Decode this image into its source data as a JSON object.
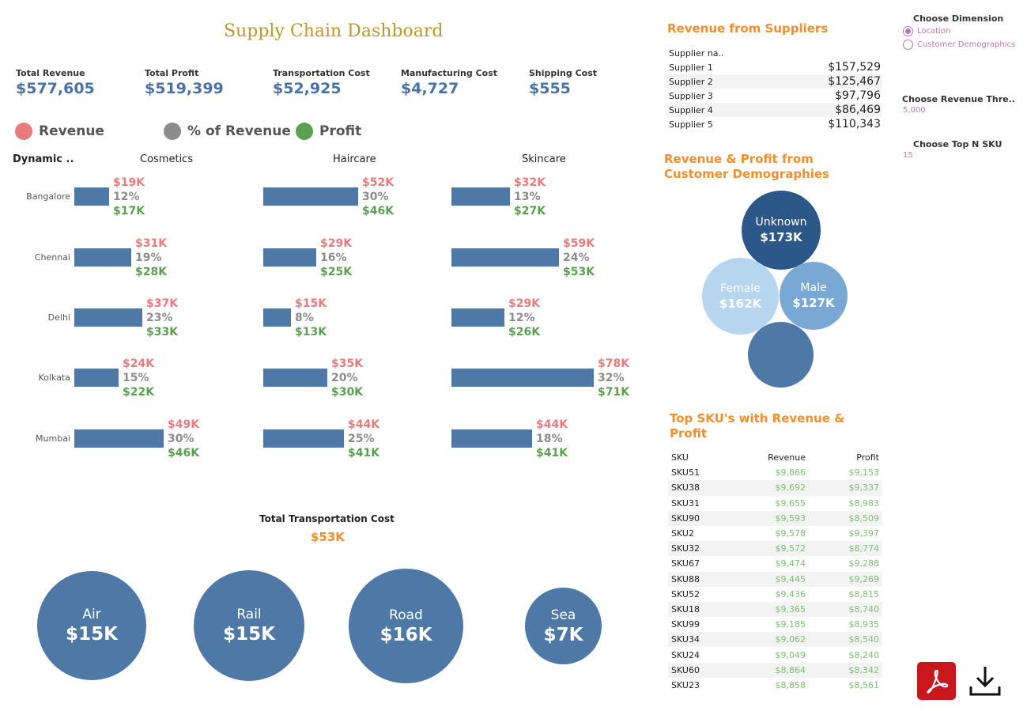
{
  "title": "Supply Chain Dashboard",
  "kpis": [
    {
      "label": "Total Revenue",
      "value": "$577,605"
    },
    {
      "label": "Total Profit",
      "value": "$519,399"
    },
    {
      "label": "Transportation Cost",
      "value": "$52,925"
    },
    {
      "label": "Manufacturing Cost",
      "value": "$4,727"
    },
    {
      "label": "Shipping Cost",
      "value": "$555"
    }
  ],
  "legend": [
    {
      "label": "Revenue",
      "color": "#e87b7b"
    },
    {
      "label": "% of Revenue",
      "color": "#8c8c8c"
    },
    {
      "label": "Profit",
      "color": "#59a14f"
    }
  ],
  "matrix": {
    "dimension_label": "Dynamic ..",
    "columns": [
      "Cosmetics",
      "Haircare",
      "Skincare"
    ],
    "rows": [
      "Bangalore",
      "Chennai",
      "Delhi",
      "Kolkata",
      "Mumbai"
    ],
    "cells": [
      [
        {
          "revenue": "$19K",
          "pct": "12%",
          "profit": "$17K",
          "value": 19
        },
        {
          "revenue": "$52K",
          "pct": "30%",
          "profit": "$46K",
          "value": 52
        },
        {
          "revenue": "$32K",
          "pct": "13%",
          "profit": "$27K",
          "value": 32
        }
      ],
      [
        {
          "revenue": "$31K",
          "pct": "19%",
          "profit": "$28K",
          "value": 31
        },
        {
          "revenue": "$29K",
          "pct": "16%",
          "profit": "$25K",
          "value": 29
        },
        {
          "revenue": "$59K",
          "pct": "24%",
          "profit": "$53K",
          "value": 59
        }
      ],
      [
        {
          "revenue": "$37K",
          "pct": "23%",
          "profit": "$33K",
          "value": 37
        },
        {
          "revenue": "$15K",
          "pct": "8%",
          "profit": "$13K",
          "value": 15
        },
        {
          "revenue": "$29K",
          "pct": "12%",
          "profit": "$26K",
          "value": 29
        }
      ],
      [
        {
          "revenue": "$24K",
          "pct": "15%",
          "profit": "$22K",
          "value": 24
        },
        {
          "revenue": "$35K",
          "pct": "20%",
          "profit": "$30K",
          "value": 35
        },
        {
          "revenue": "$78K",
          "pct": "32%",
          "profit": "$71K",
          "value": 78
        }
      ],
      [
        {
          "revenue": "$49K",
          "pct": "30%",
          "profit": "$46K",
          "value": 49
        },
        {
          "revenue": "$44K",
          "pct": "25%",
          "profit": "$41K",
          "value": 44
        },
        {
          "revenue": "$44K",
          "pct": "18%",
          "profit": "$41K",
          "value": 44
        }
      ]
    ]
  },
  "transport": {
    "title": "Total Transportation Cost",
    "total": "$53K",
    "modes": [
      {
        "name": "Air",
        "label": "$15K",
        "value": 15
      },
      {
        "name": "Rail",
        "label": "$15K",
        "value": 15
      },
      {
        "name": "Road",
        "label": "$16K",
        "value": 16
      },
      {
        "name": "Sea",
        "label": "$7K",
        "value": 7
      }
    ]
  },
  "suppliers": {
    "title": "Revenue from Suppliers",
    "header": "Supplier na..",
    "rows": [
      {
        "name": "Supplier 1",
        "value": "$157,529"
      },
      {
        "name": "Supplier 2",
        "value": "$125,467"
      },
      {
        "name": "Supplier 3",
        "value": "$97,796"
      },
      {
        "name": "Supplier 4",
        "value": "$86,469"
      },
      {
        "name": "Supplier 5",
        "value": "$110,343"
      }
    ]
  },
  "demographics": {
    "title": "Revenue & Profit from Customer Demographies",
    "bubbles": [
      {
        "name": "Unknown",
        "value": "$173K",
        "color": "#2b5888"
      },
      {
        "name": "Female",
        "value": "$162K",
        "color": "#b5d6ee"
      },
      {
        "name": "Male",
        "value": "$127K",
        "color": "#7aa8d4"
      },
      {
        "name": "",
        "value": "",
        "color": "#4e79a7"
      }
    ]
  },
  "skus": {
    "title": "Top SKU's with Revenue & Profit",
    "headers": [
      "SKU",
      "Revenue",
      "Profit"
    ],
    "rows": [
      [
        "SKU51",
        "$9,866",
        "$9,153"
      ],
      [
        "SKU38",
        "$9,692",
        "$9,337"
      ],
      [
        "SKU31",
        "$9,655",
        "$8,983"
      ],
      [
        "SKU90",
        "$9,593",
        "$8,509"
      ],
      [
        "SKU2",
        "$9,578",
        "$9,397"
      ],
      [
        "SKU32",
        "$9,572",
        "$8,774"
      ],
      [
        "SKU67",
        "$9,474",
        "$9,288"
      ],
      [
        "SKU88",
        "$9,445",
        "$9,269"
      ],
      [
        "SKU52",
        "$9,436",
        "$8,815"
      ],
      [
        "SKU18",
        "$9,365",
        "$8,740"
      ],
      [
        "SKU99",
        "$9,185",
        "$8,935"
      ],
      [
        "SKU34",
        "$9,062",
        "$8,540"
      ],
      [
        "SKU24",
        "$9,049",
        "$8,240"
      ],
      [
        "SKU60",
        "$8,864",
        "$8,342"
      ],
      [
        "SKU23",
        "$8,858",
        "$8,561"
      ]
    ]
  },
  "controls": {
    "dimension_title": "Choose Dimension",
    "dimension_options": [
      "Location",
      "Customer Demographics"
    ],
    "dimension_selected": "Location",
    "threshold_title": "Choose Revenue Thre..",
    "threshold_value": "5,000",
    "topn_title": "Choose Top N SKU",
    "topn_value": "15"
  },
  "icons": {
    "pdf": "pdf-icon",
    "download": "download-icon"
  }
}
